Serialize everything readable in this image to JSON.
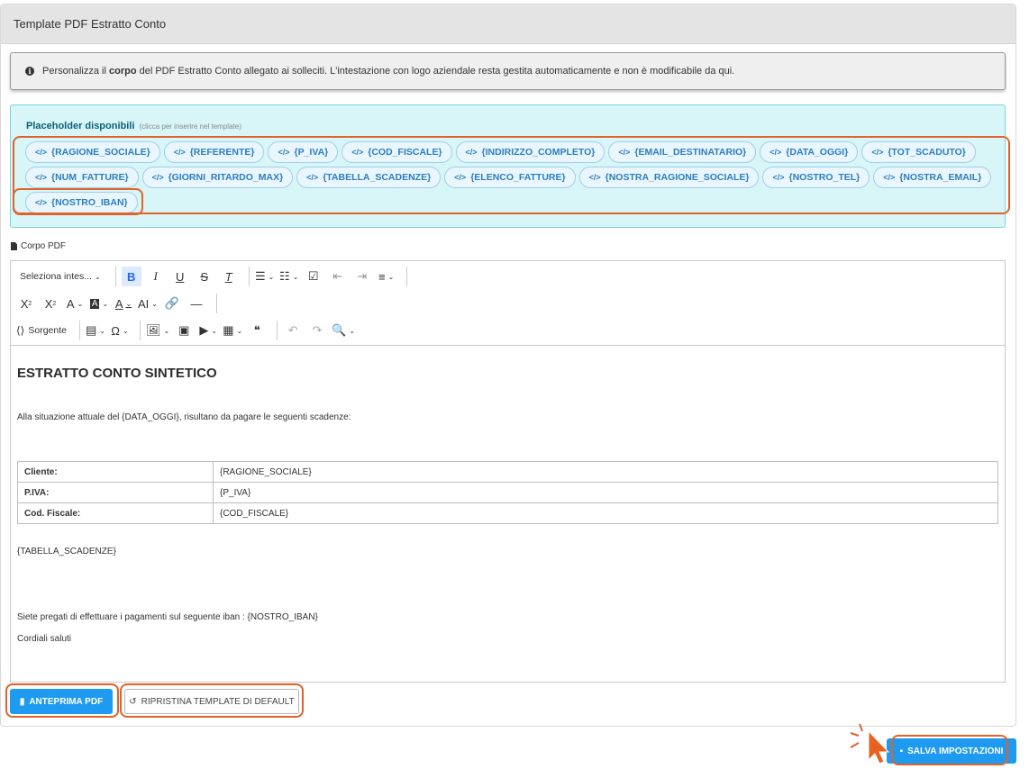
{
  "card": {
    "title": "Template PDF Estratto Conto"
  },
  "info": {
    "icon": "info-circle-icon",
    "text_before": "Personalizza il ",
    "text_bold": "corpo",
    "text_after": " del PDF Estratto Conto allegato ai solleciti. L'intestazione con logo aziendale resta gestita automaticamente e non è modificabile da qui."
  },
  "placeholders": {
    "title": "Placeholder disponibili",
    "hint": "(clicca per inserire nel template)",
    "code_icon": "</>",
    "rows": [
      [
        "{RAGIONE_SOCIALE}",
        "{REFERENTE}",
        "{P_IVA}",
        "{COD_FISCALE}",
        "{INDIRIZZO_COMPLETO}",
        "{EMAIL_DESTINATARIO}",
        "{DATA_OGGI}",
        "{TOT_SCADUTO}"
      ],
      [
        "{NUM_FATTURE}",
        "{GIORNI_RITARDO_MAX}",
        "{TABELLA_SCADENZE}",
        "{ELENCO_FATTURE}",
        "{NOSTRA_RAGIONE_SOCIALE}",
        "{NOSTRO_TEL}",
        "{NOSTRA_EMAIL}"
      ],
      [
        "{NOSTRO_IBAN}"
      ]
    ]
  },
  "corpo": {
    "label": "Corpo PDF",
    "icon": "pdf-file-icon"
  },
  "toolbar": {
    "heading_select": "Seleziona intes...",
    "bold": "B",
    "italic": "I",
    "underline": "U",
    "strike": "S",
    "clear": "T",
    "subscript": "X",
    "superscript": "X",
    "source": "Sorgente"
  },
  "document": {
    "title": "ESTRATTO CONTO SINTETICO",
    "intro": "Alla situazione attuale del {DATA_OGGI}, risultano da pagare le seguenti scadenze:",
    "table": [
      {
        "label": "Cliente:",
        "value": "{RAGIONE_SOCIALE}"
      },
      {
        "label": "P.IVA:",
        "value": "{P_IVA}"
      },
      {
        "label": "Cod. Fiscale:",
        "value": "{COD_FISCALE}"
      }
    ],
    "tabella": "{TABELLA_SCADENZE}",
    "iban_line": "Siete pregati di effettuare i pagamenti sul seguente iban : {NOSTRO_IBAN}",
    "closing": "Cordiali saluti"
  },
  "actions": {
    "preview": "ANTEPRIMA PDF",
    "reset": "RIPRISTINA TEMPLATE DI DEFAULT",
    "save": "SALVA IMPOSTAZIONI"
  },
  "colors": {
    "primary": "#1e9af0",
    "highlight": "#e1622a",
    "placeholder_bg": "#d8f5f7"
  }
}
